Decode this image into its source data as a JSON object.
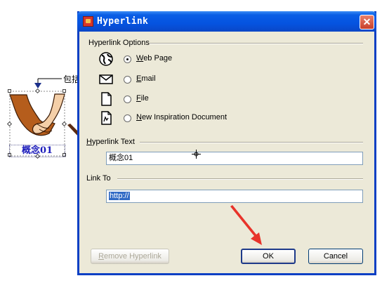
{
  "background": {
    "connector_label": "包括",
    "concept_label": "概念01"
  },
  "dialog": {
    "title": "Hyperlink",
    "close_glyph": "✕",
    "options_group": {
      "label": "Hyperlink Options",
      "items": [
        {
          "mnemonic": "W",
          "rest": "eb Page",
          "icon": "globe-icon",
          "checked": true
        },
        {
          "mnemonic": "E",
          "rest": "mail",
          "icon": "envelope-icon",
          "checked": false
        },
        {
          "mnemonic": "F",
          "rest": "ile",
          "icon": "file-icon",
          "checked": false
        },
        {
          "mnemonic": "N",
          "rest": "ew Inspiration Document",
          "icon": "inspiration-doc-icon",
          "checked": false
        }
      ]
    },
    "hyperlink_text": {
      "label_mnemonic": "H",
      "label_rest": "yperlink Text",
      "value": "概念01"
    },
    "link_to": {
      "label": "Link To",
      "value": "http://"
    },
    "buttons": {
      "remove_mnemonic": "R",
      "remove_rest": "emove Hyperlink",
      "ok": "OK",
      "cancel": "Cancel"
    }
  },
  "colors": {
    "titlebar": "#0553e0",
    "dialog_face": "#ece9d8",
    "selection": "#316ac5",
    "annotation_arrow": "#e8332a"
  }
}
